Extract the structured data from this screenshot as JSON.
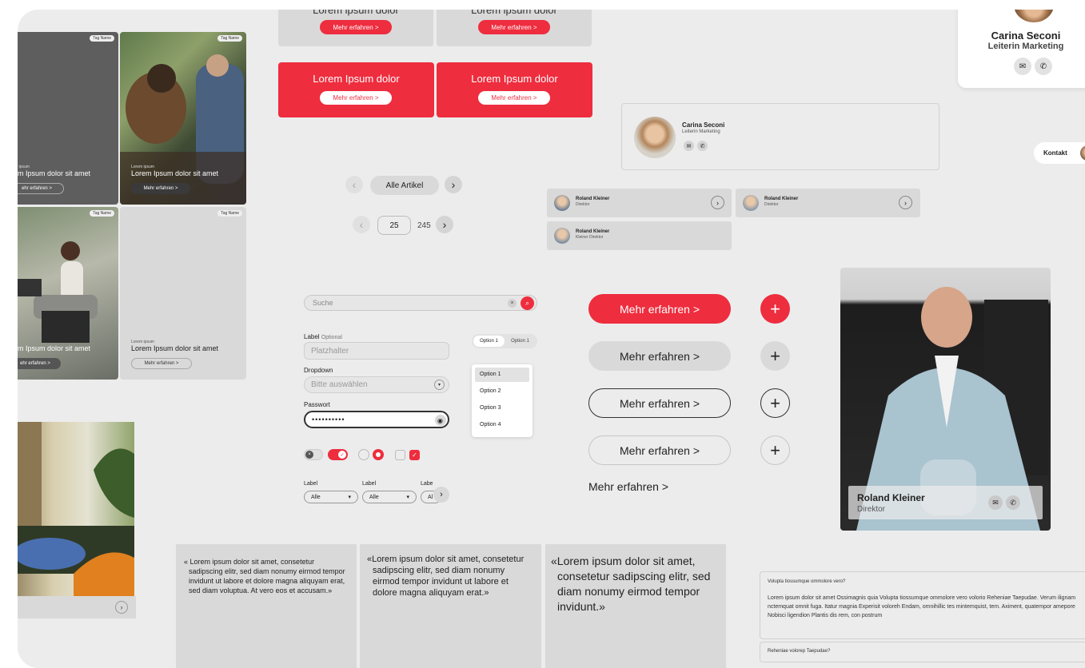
{
  "promo_top": {
    "title": "Lorem ipsum dolor",
    "button": "Mehr erfahren >"
  },
  "promo_red": {
    "title": "Lorem Ipsum dolor",
    "button": "Mehr erfahren >"
  },
  "contact_card_top": {
    "name": "Carina Seconi",
    "role": "Leiterin Marketing"
  },
  "contact_card_mid": {
    "name": "Carina Seconi",
    "role": "Leiterin Marketing"
  },
  "kontakt_tab": {
    "label": "Kontakt"
  },
  "cards": {
    "tag": "Tag Name",
    "kicker": "Lorem ipsum",
    "title": "Lorem Ipsum dolor sit amet",
    "title_cut": "m Ipsum dolor sit amet",
    "button": "Mehr erfahren >",
    "button_cut": "ehr erfahren >"
  },
  "pagination": {
    "all_articles": "Alle Artikel",
    "current_page": "25",
    "total_pages": "245"
  },
  "people": [
    {
      "name": "Roland Kleiner",
      "role": "Direktor"
    },
    {
      "name": "Roland Kleiner",
      "role": "Direktor"
    },
    {
      "name": "Roland Kleiner",
      "role": "Kleiner Direktor"
    }
  ],
  "search": {
    "placeholder": "Suche"
  },
  "form": {
    "label": "Label",
    "optional": "Optional",
    "placeholder": "Platzhalter",
    "dropdown_label": "Dropdown",
    "dropdown_value": "Bitte auswählen",
    "password_label": "Passwort",
    "password_value": "••••••••••"
  },
  "segmented": [
    "Option 1",
    "Option 1"
  ],
  "dropdown_options": [
    "Option 1",
    "Option 2",
    "Option 3",
    "Option 4"
  ],
  "filters": [
    {
      "label": "Label",
      "value": "Alle"
    },
    {
      "label": "Label",
      "value": "Alle"
    },
    {
      "label": "Labe",
      "value": "Al"
    }
  ],
  "buttons": {
    "more": "Mehr erfahren >"
  },
  "portrait": {
    "name": "Roland Kleiner",
    "role": "Direktor"
  },
  "quotes": [
    "« Lorem ipsum dolor sit amet, consetetur sadipscing elitr, sed diam nonumy eirmod tempor invidunt ut labore et dolore magna aliquyam erat, sed diam voluptua. At vero eos et accusam.»",
    "«Lorem ipsum dolor sit amet, consetetur sadipscing elitr, sed diam nonumy eirmod tempor invidunt ut labore et dolore magna aliquyam erat.»",
    "«Lorem ipsum dolor sit amet, consetetur sadipscing elitr, sed diam nonumy eirmod tempor invidunt.»"
  ],
  "faq": {
    "q1": "Volupta tiossumque ommolore vero?",
    "a1": "Lorem ipsum dolor sit amet Ossimagnis quia Volupta tiossumque ommolore vero volorio Reheniae Taepudae. Verum ilignam nctemquat omnit fuga. Itatur magnia Experisit voloreh Endam, omnihillic tes mintemquist, tem. Aximent, quatempor amepore Nobisci ligendion Plantis dis rem, con postrum",
    "q2": "Reheniae volorep Taepudae?"
  },
  "colors": {
    "accent": "#ee2d3e",
    "board": "#ececec",
    "card": "#d9d9d9"
  }
}
